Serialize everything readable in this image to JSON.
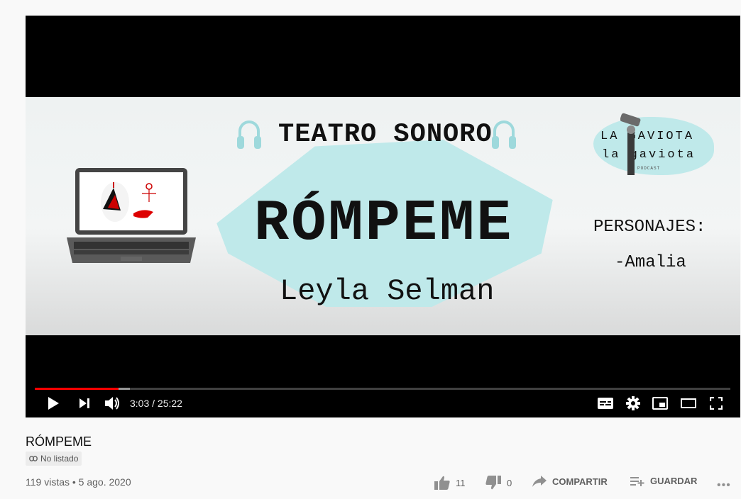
{
  "video_frame": {
    "header": "TEATRO SONORO",
    "title": "RÓMPEME",
    "author": "Leyla Selman",
    "characters_label": "PERSONAJES:",
    "characters": "-Amalia",
    "logo_line1": "LA GAVIOTA",
    "logo_line2": "la gaviota",
    "logo_sub": "PODCAST",
    "accent_color": "#bfe9ea"
  },
  "player": {
    "time": "3:03 / 25:22",
    "progress_fraction": 0.12,
    "buffered_fraction": 0.137,
    "progress_color": "#ff0000",
    "icons": [
      "play-icon",
      "next-icon",
      "volume-icon",
      "subtitles-icon",
      "settings-icon",
      "miniplayer-icon",
      "theater-mode-icon",
      "fullscreen-icon"
    ]
  },
  "info": {
    "title": "RÓMPEME",
    "visibility": "No listado",
    "views_date": "119 vistas • 5 ago. 2020"
  },
  "actions": {
    "likes": "11",
    "dislikes": "0",
    "share": "COMPARTIR",
    "save": "GUARDAR",
    "more": "•••"
  }
}
